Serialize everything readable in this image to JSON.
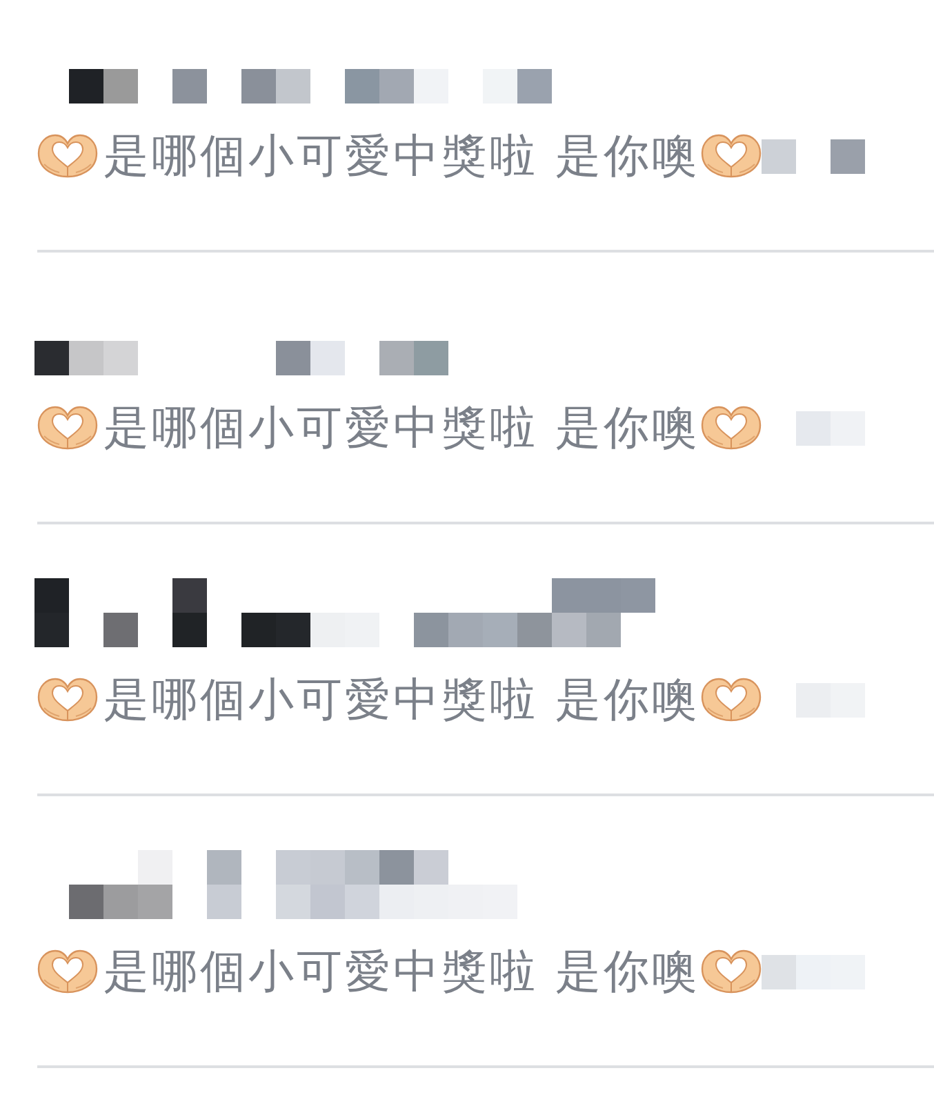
{
  "comments": [
    {
      "text": "是哪個小可愛中獎啦 是你噢"
    },
    {
      "text": "是哪個小可愛中獎啦 是你噢"
    },
    {
      "text": "是哪個小可愛中獎啦 是你噢"
    },
    {
      "text": "是哪個小可愛中獎啦 是你噢"
    }
  ]
}
